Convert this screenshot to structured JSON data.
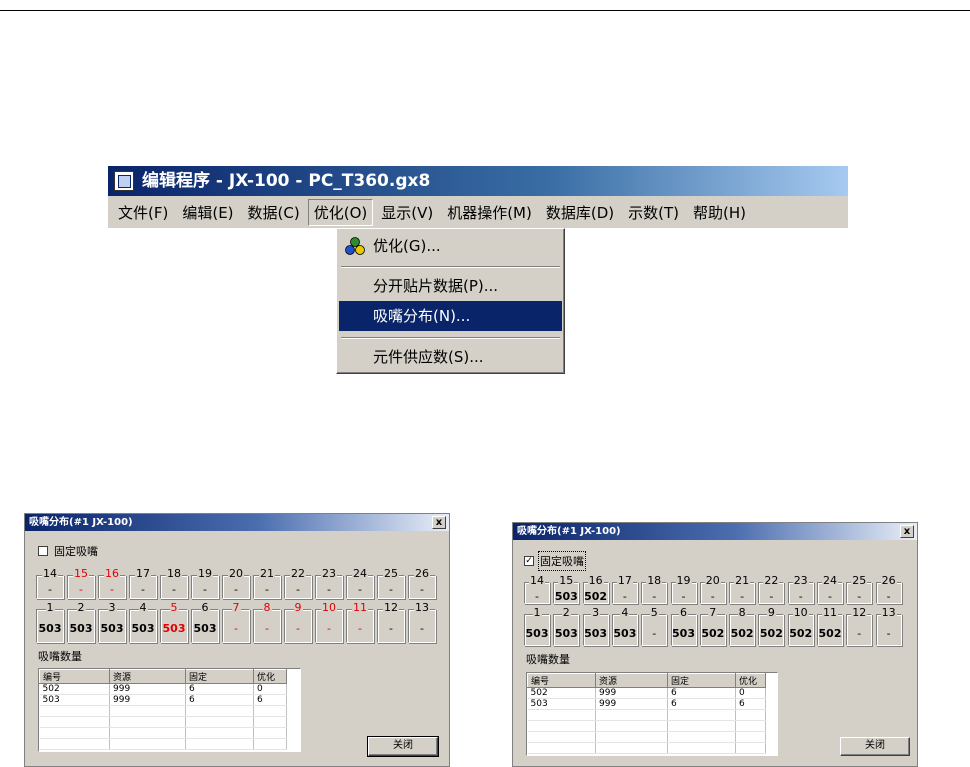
{
  "app": {
    "title": "编辑程序  - JX-100 - PC_T360.gx8",
    "menu": [
      "文件(F)",
      "编辑(E)",
      "数据(C)",
      "优化(O)",
      "显示(V)",
      "机器操作(M)",
      "数据库(D)",
      "示数(T)",
      "帮助(H)"
    ]
  },
  "dropdown": {
    "items": [
      "优化(G)...",
      "分开贴片数据(P)...",
      "吸嘴分布(N)...",
      "元件供应数(S)..."
    ],
    "highlighted": "吸嘴分布(N)..."
  },
  "dialog_left": {
    "title": "吸嘴分布(#1 JX-100)",
    "close_glyph": "x",
    "checkbox_label": "固定吸嘴",
    "checked": false,
    "top_row": [
      {
        "num": "14",
        "val": "-",
        "red": false
      },
      {
        "num": "15",
        "val": "-",
        "red": true
      },
      {
        "num": "16",
        "val": "-",
        "red": true
      },
      {
        "num": "17",
        "val": "-",
        "red": false
      },
      {
        "num": "18",
        "val": "-",
        "red": false
      },
      {
        "num": "19",
        "val": "-",
        "red": false
      },
      {
        "num": "20",
        "val": "-",
        "red": false
      },
      {
        "num": "21",
        "val": "-",
        "red": false
      },
      {
        "num": "22",
        "val": "-",
        "red": false
      },
      {
        "num": "23",
        "val": "-",
        "red": false
      },
      {
        "num": "24",
        "val": "-",
        "red": false
      },
      {
        "num": "25",
        "val": "-",
        "red": false
      },
      {
        "num": "26",
        "val": "-",
        "red": false
      }
    ],
    "bottom_row": [
      {
        "num": "1",
        "val": "503",
        "red": false
      },
      {
        "num": "2",
        "val": "503",
        "red": false
      },
      {
        "num": "3",
        "val": "503",
        "red": false
      },
      {
        "num": "4",
        "val": "503",
        "red": false
      },
      {
        "num": "5",
        "val": "503",
        "red": true
      },
      {
        "num": "6",
        "val": "503",
        "red": false
      },
      {
        "num": "7",
        "val": "-",
        "red": true
      },
      {
        "num": "8",
        "val": "-",
        "red": true
      },
      {
        "num": "9",
        "val": "-",
        "red": true
      },
      {
        "num": "10",
        "val": "-",
        "red": true
      },
      {
        "num": "11",
        "val": "-",
        "red": true
      },
      {
        "num": "12",
        "val": "-",
        "red": false
      },
      {
        "num": "13",
        "val": "-",
        "red": false
      }
    ],
    "section_label": "吸嘴数量",
    "columns": [
      "编号",
      "资源",
      "固定",
      "优化"
    ],
    "rows": [
      [
        "502",
        "999",
        "6",
        "0"
      ],
      [
        "503",
        "999",
        "6",
        "6"
      ]
    ],
    "close_button": "关闭"
  },
  "dialog_right": {
    "title": "吸嘴分布(#1 JX-100)",
    "close_glyph": "x",
    "checkbox_label": "固定吸嘴",
    "checked": true,
    "check_glyph": "✓",
    "top_row": [
      {
        "num": "14",
        "val": "-",
        "red": false
      },
      {
        "num": "15",
        "val": "503",
        "red": false
      },
      {
        "num": "16",
        "val": "502",
        "red": false
      },
      {
        "num": "17",
        "val": "-",
        "red": false
      },
      {
        "num": "18",
        "val": "-",
        "red": false
      },
      {
        "num": "19",
        "val": "-",
        "red": false
      },
      {
        "num": "20",
        "val": "-",
        "red": false
      },
      {
        "num": "21",
        "val": "-",
        "red": false
      },
      {
        "num": "22",
        "val": "-",
        "red": false
      },
      {
        "num": "23",
        "val": "-",
        "red": false
      },
      {
        "num": "24",
        "val": "-",
        "red": false
      },
      {
        "num": "25",
        "val": "-",
        "red": false
      },
      {
        "num": "26",
        "val": "-",
        "red": false
      }
    ],
    "bottom_row": [
      {
        "num": "1",
        "val": "503",
        "red": false
      },
      {
        "num": "2",
        "val": "503",
        "red": false
      },
      {
        "num": "3",
        "val": "503",
        "red": false
      },
      {
        "num": "4",
        "val": "503",
        "red": false
      },
      {
        "num": "5",
        "val": "-",
        "red": false
      },
      {
        "num": "6",
        "val": "503",
        "red": false
      },
      {
        "num": "7",
        "val": "502",
        "red": false
      },
      {
        "num": "8",
        "val": "502",
        "red": false
      },
      {
        "num": "9",
        "val": "502",
        "red": false
      },
      {
        "num": "10",
        "val": "502",
        "red": false
      },
      {
        "num": "11",
        "val": "502",
        "red": false
      },
      {
        "num": "12",
        "val": "-",
        "red": false
      },
      {
        "num": "13",
        "val": "-",
        "red": false
      }
    ],
    "section_label": "吸嘴数量",
    "columns": [
      "编号",
      "资源",
      "固定",
      "优化"
    ],
    "rows": [
      [
        "502",
        "999",
        "6",
        "0"
      ],
      [
        "503",
        "999",
        "6",
        "6"
      ]
    ],
    "close_button": "关闭"
  },
  "colors": {
    "highlight": "#0a246a",
    "red": "#e00000",
    "face": "#d4d0c8"
  }
}
